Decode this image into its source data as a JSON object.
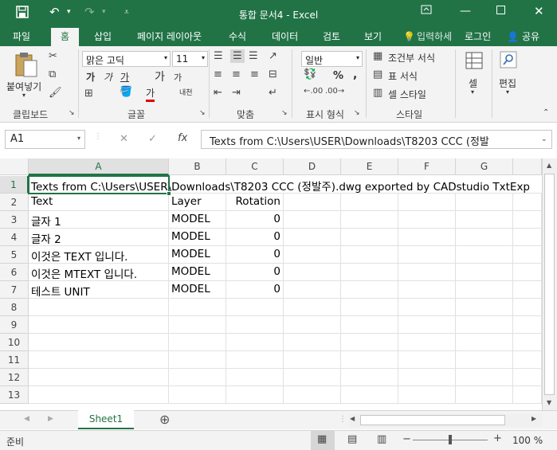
{
  "window": {
    "title": "통합 문서4 - Excel",
    "save_icon": "save-icon",
    "undo_icon": "undo-icon",
    "redo_icon": "redo-icon"
  },
  "tabs": [
    {
      "label": "파일"
    },
    {
      "label": "홈"
    },
    {
      "label": "삽입"
    },
    {
      "label": "페이지 레이아웃"
    },
    {
      "label": "수식"
    },
    {
      "label": "데이터"
    },
    {
      "label": "검토"
    },
    {
      "label": "보기"
    }
  ],
  "tellme": "입력하세",
  "login": "로그인",
  "share": "공유",
  "ribbon": {
    "paste": "붙여넣기",
    "clipboard": "클립보드",
    "font_name": "맑은 고딕",
    "font_size": "11",
    "font_group": "글꼴",
    "bold": "가",
    "italic": "가",
    "underline": "가",
    "grow": "가",
    "shrink": "가",
    "font_color": "가",
    "phonetic": "내천",
    "align_group": "맞춤",
    "number_format": "일반",
    "number_group": "표시 형식",
    "percent": "%",
    "comma": ",",
    "cond_format": "조건부 서식",
    "table_format": "표 서식",
    "cell_style": "셀 스타일",
    "style_group": "스타일",
    "cells": "셀",
    "editing": "편집"
  },
  "formula": {
    "namebox": "A1",
    "fx": "fx",
    "content": "Texts from C:\\Users\\USER\\Downloads\\T8203 CCC (정발"
  },
  "columns": [
    "A",
    "B",
    "C",
    "D",
    "E",
    "F",
    "G"
  ],
  "rows": [
    {
      "n": "1",
      "a": "Texts from C:\\Users\\USER\\Downloads\\T8203 CCC (정발주).dwg exported by CADstudio TxtExp",
      "b": "",
      "c": ""
    },
    {
      "n": "2",
      "a": "Text",
      "b": "Layer",
      "c": "Rotation"
    },
    {
      "n": "3",
      "a": "글자 1",
      "b": "MODEL",
      "c": "0"
    },
    {
      "n": "4",
      "a": "글자 2",
      "b": "MODEL",
      "c": "0"
    },
    {
      "n": "5",
      "a": "이것은 TEXT 입니다.",
      "b": "MODEL",
      "c": "0"
    },
    {
      "n": "6",
      "a": "이것은 MTEXT 입니다.",
      "b": "MODEL",
      "c": "0"
    },
    {
      "n": "7",
      "a": "테스트 UNIT",
      "b": "MODEL",
      "c": "0"
    },
    {
      "n": "8",
      "a": "",
      "b": "",
      "c": ""
    },
    {
      "n": "9",
      "a": "",
      "b": "",
      "c": ""
    },
    {
      "n": "10",
      "a": "",
      "b": "",
      "c": ""
    },
    {
      "n": "11",
      "a": "",
      "b": "",
      "c": ""
    },
    {
      "n": "12",
      "a": "",
      "b": "",
      "c": ""
    },
    {
      "n": "13",
      "a": "",
      "b": "",
      "c": ""
    }
  ],
  "sheet": {
    "tab": "Sheet1"
  },
  "status": {
    "ready": "준비",
    "zoom": "100 %"
  },
  "colors": {
    "accent": "#217346"
  }
}
